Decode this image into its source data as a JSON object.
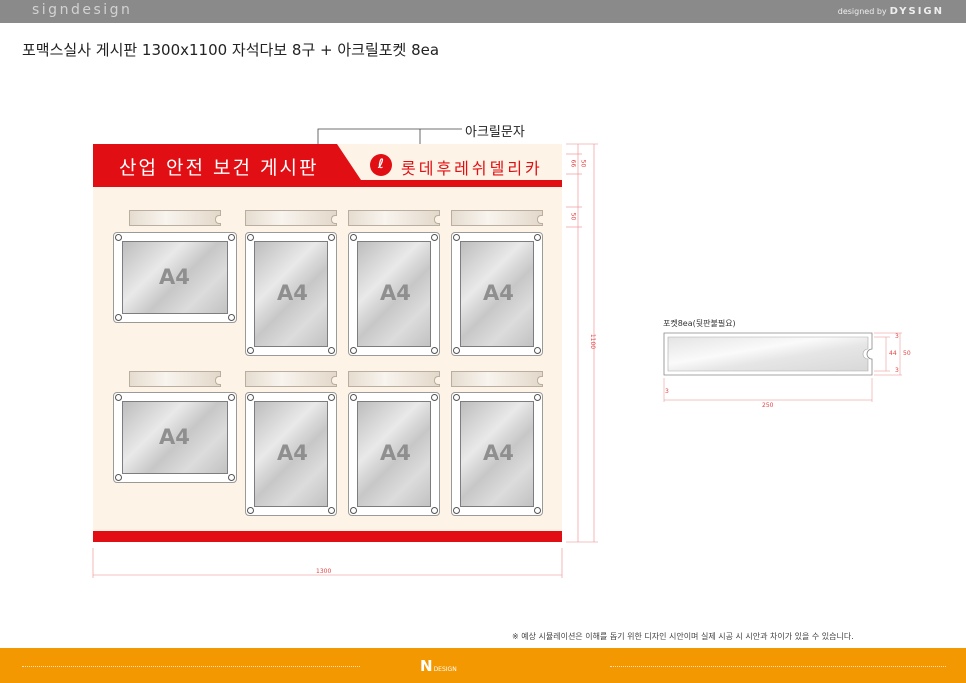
{
  "top_bar": {
    "brand": "signdesign",
    "designed_prefix": "designed by",
    "designed_brand": "DYSIGN"
  },
  "title": "포맥스실사 게시판 1300x1100 자석다보 8구 + 아크릴포켓 8ea",
  "callout": {
    "label": "아크릴문자"
  },
  "board": {
    "header_title": "산업 안전 보건 게시판",
    "brand_text": "롯데후레쉬델리카",
    "colors": {
      "red": "#e10f14",
      "yellow": "#f5c200",
      "background": "#fdf3e6"
    },
    "pocket_label": "A4",
    "pocket_count": 8
  },
  "dimensions": {
    "width": "1300",
    "height": "1100",
    "header_a": "66",
    "header_b": "50",
    "header_c": "50"
  },
  "detail": {
    "title": "포켓8ea(뒷판불필요)",
    "width": "250",
    "height_outer": "50",
    "height_inner": "44",
    "edge_top": "3",
    "edge_bottom": "3",
    "edge_left": "3"
  },
  "note": "※ 예상 시뮬레이션은  이해를 돕기 위한 디자인 시안이며 실제 시공 시 시안과 차이가 있을 수 있습니다.",
  "footer": {
    "logo_mark": "N",
    "logo_text": "DESIGN"
  }
}
